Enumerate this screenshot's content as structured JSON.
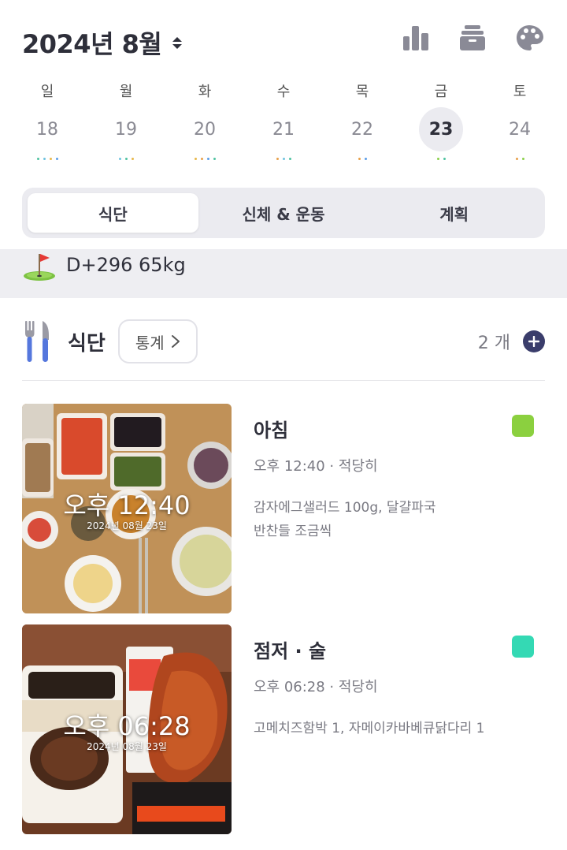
{
  "header": {
    "title": "2024년 8월"
  },
  "week": [
    {
      "dow": "일",
      "date": "18",
      "selected": false,
      "dots": [
        "#4fc3a1",
        "#6fc3e0",
        "#e8b84a",
        "#5c9ee8"
      ]
    },
    {
      "dow": "월",
      "date": "19",
      "selected": false,
      "dots": [
        "#6fc3e0",
        "#4fc3a1",
        "#e8b84a"
      ]
    },
    {
      "dow": "화",
      "date": "20",
      "selected": false,
      "dots": [
        "#e8b84a",
        "#e8a04a",
        "#5c9ee8",
        "#4fc3a1"
      ]
    },
    {
      "dow": "수",
      "date": "21",
      "selected": false,
      "dots": [
        "#e8a04a",
        "#6fc3e0",
        "#4fc3a1"
      ]
    },
    {
      "dow": "목",
      "date": "22",
      "selected": false,
      "dots": [
        "#e8a04a",
        "#5c9ee8"
      ]
    },
    {
      "dow": "금",
      "date": "23",
      "selected": true,
      "dots": [
        "#8bd04a",
        "#4fc3a1"
      ]
    },
    {
      "dow": "토",
      "date": "24",
      "selected": false,
      "dots": [
        "#e8a04a",
        "#8bd04a"
      ]
    }
  ],
  "tabs": [
    {
      "label": "식단",
      "active": true
    },
    {
      "label": "신체 & 운동",
      "active": false
    },
    {
      "label": "계획",
      "active": false
    }
  ],
  "goal": {
    "text": "D+296 65kg"
  },
  "section": {
    "title": "식단",
    "stats_label": "통계",
    "count": "2 개"
  },
  "meals": [
    {
      "name": "아침",
      "meta": "오후 12:40 · 적당히",
      "desc": "감자에그샐러드 100g, 달걀파국\n반찬들 조금씩",
      "photo_time": "오후 12:40",
      "photo_date": "2024년 08월 23일",
      "color": "#8bd03f"
    },
    {
      "name": "점저 · 술",
      "meta": "오후 06:28 · 적당히",
      "desc": "고메치즈함박 1, 자메이카바베큐닭다리 1",
      "photo_time": "오후 06:28",
      "photo_date": "2024년 08월 23일",
      "color": "#34d9b4"
    }
  ],
  "colors": {
    "accent": "#3a3d6b",
    "selected_bg": "#ebebf0"
  }
}
